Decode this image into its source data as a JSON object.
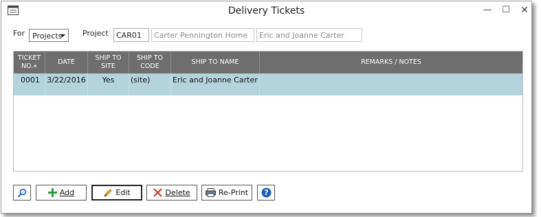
{
  "window": {
    "title": "Delivery Tickets",
    "controls": {
      "minimize": "—",
      "maximize": "☐",
      "close": "✕"
    }
  },
  "filters": {
    "for_label": "For",
    "for_select_value": "Projects",
    "project_label": "Project",
    "project_code": "CAR01",
    "project_name": "Carter Pennington Home",
    "client_name": "Eric and Joanne Carter"
  },
  "grid": {
    "columns": [
      "TICKET NO.«",
      "DATE",
      "SHIP TO SITE",
      "SHIP TO CODE",
      "SHIP TO NAME",
      "REMARKS / NOTES"
    ],
    "rows": [
      {
        "ticket_no": "0001",
        "date": "3/22/2016",
        "ship_to_site": "Yes",
        "ship_to_code": "(site)",
        "ship_to_name": "Eric and Joanne Carter",
        "remarks": ""
      }
    ]
  },
  "toolbar": {
    "search_icon": "magnifier-icon",
    "add_label": "Add",
    "edit_label": "Edit",
    "delete_label": "Delete",
    "reprint_label": "Re-Print",
    "help_icon": "question-icon"
  },
  "colors": {
    "header_bg": "#6e6e6e",
    "selected_row_bg": "#b5d3dd",
    "add_icon": "#2e9e3c",
    "delete_icon": "#d23a2a",
    "help_icon": "#1f5fb5"
  }
}
